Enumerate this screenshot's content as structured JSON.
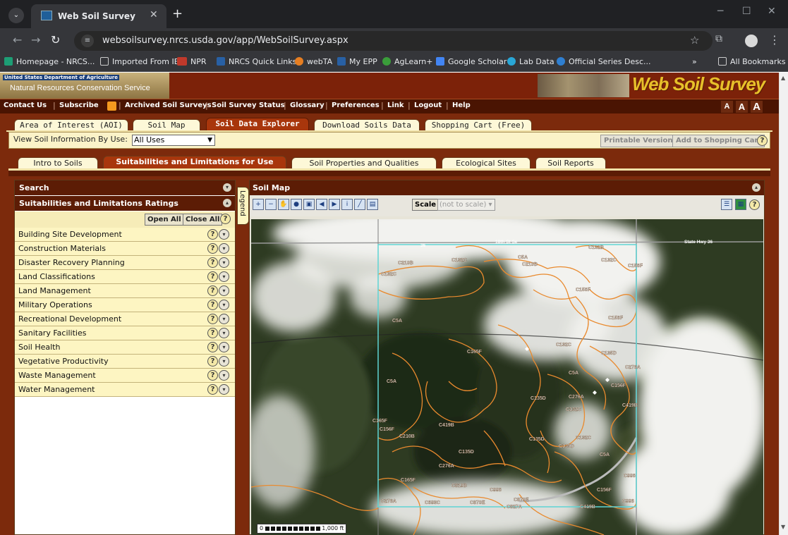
{
  "browser": {
    "tab_title": "Web Soil Survey",
    "url": "websoilsurvey.nrcs.usda.gov/app/WebSoilSurvey.aspx",
    "bookmarks": [
      "Homepage - NRCS...",
      "Imported From IE",
      "NPR",
      "NRCS Quick Links",
      "webTA",
      "My EPP",
      "AgLearn+",
      "Google Scholar",
      "Lab Data",
      "Official Series Desc..."
    ],
    "all_bookmarks": "All Bookmarks",
    "overflow": "»"
  },
  "banner": {
    "agency_line1": "United States Department of Agriculture",
    "agency_line2": "Natural Resources Conservation Service",
    "title": "Web Soil Survey"
  },
  "topnav": {
    "items": [
      "Contact Us",
      "Subscribe",
      "Archived Soil Surveys",
      "Soil Survey Status",
      "Glossary",
      "Preferences",
      "Link",
      "Logout",
      "Help"
    ],
    "text_size": [
      "A",
      "A",
      "A"
    ]
  },
  "main_tabs": [
    "Area of Interest (AOI)",
    "Soil Map",
    "Soil Data Explorer",
    "Download Soils Data",
    "Shopping Cart (Free)"
  ],
  "view_bar": {
    "label": "View Soil Information By Use:",
    "selected": "All Uses",
    "printable": "Printable Version",
    "add_cart": "Add to Shopping Cart"
  },
  "sub_tabs": [
    "Intro to Soils",
    "Suitabilities and Limitations for Use",
    "Soil Properties and Qualities",
    "Ecological Sites",
    "Soil Reports"
  ],
  "left_panel": {
    "search_title": "Search",
    "ratings_title": "Suitabilities and Limitations Ratings",
    "open_all": "Open All",
    "close_all": "Close All",
    "categories": [
      "Building Site Development",
      "Construction Materials",
      "Disaster Recovery Planning",
      "Land Classifications",
      "Land Management",
      "Military Operations",
      "Recreational Development",
      "Sanitary Facilities",
      "Soil Health",
      "Vegetative Productivity",
      "Waste Management",
      "Water Management"
    ]
  },
  "legend_label": "Legend",
  "map": {
    "title": "Soil Map",
    "scale_label": "Scale",
    "scale_value": "(not to scale)",
    "scale_bar": "1,000 ft",
    "road_labels": [
      "18th St Se",
      "State Hwy 36",
      "36"
    ],
    "units": [
      "C210B",
      "C132C",
      "C5A",
      "C210B",
      "C132B",
      "C132C",
      "C156F",
      "C132C",
      "C156F",
      "C156F",
      "C5A",
      "C165F",
      "C132C",
      "C135D",
      "C5A",
      "C5A",
      "C276A",
      "C156F",
      "C135D",
      "C276A",
      "C132C",
      "C419B",
      "C165F",
      "C156F",
      "C210B",
      "C419B",
      "C135D",
      "C132C",
      "C135D",
      "C135D",
      "C276A",
      "C5A",
      "C165F",
      "C819B",
      "C996",
      "C276A",
      "C693C",
      "C870E",
      "C870E",
      "C827A",
      "C419B",
      "C156F",
      "C996",
      "C996"
    ]
  },
  "colors": {
    "banner_bg": "#7c2209",
    "nav_bg": "#4a1402",
    "active_tab": "#a8360c",
    "panel_row": "#fdf5c2",
    "soil_line": "#e98a2e",
    "aoi_line": "#5fd4d4"
  }
}
